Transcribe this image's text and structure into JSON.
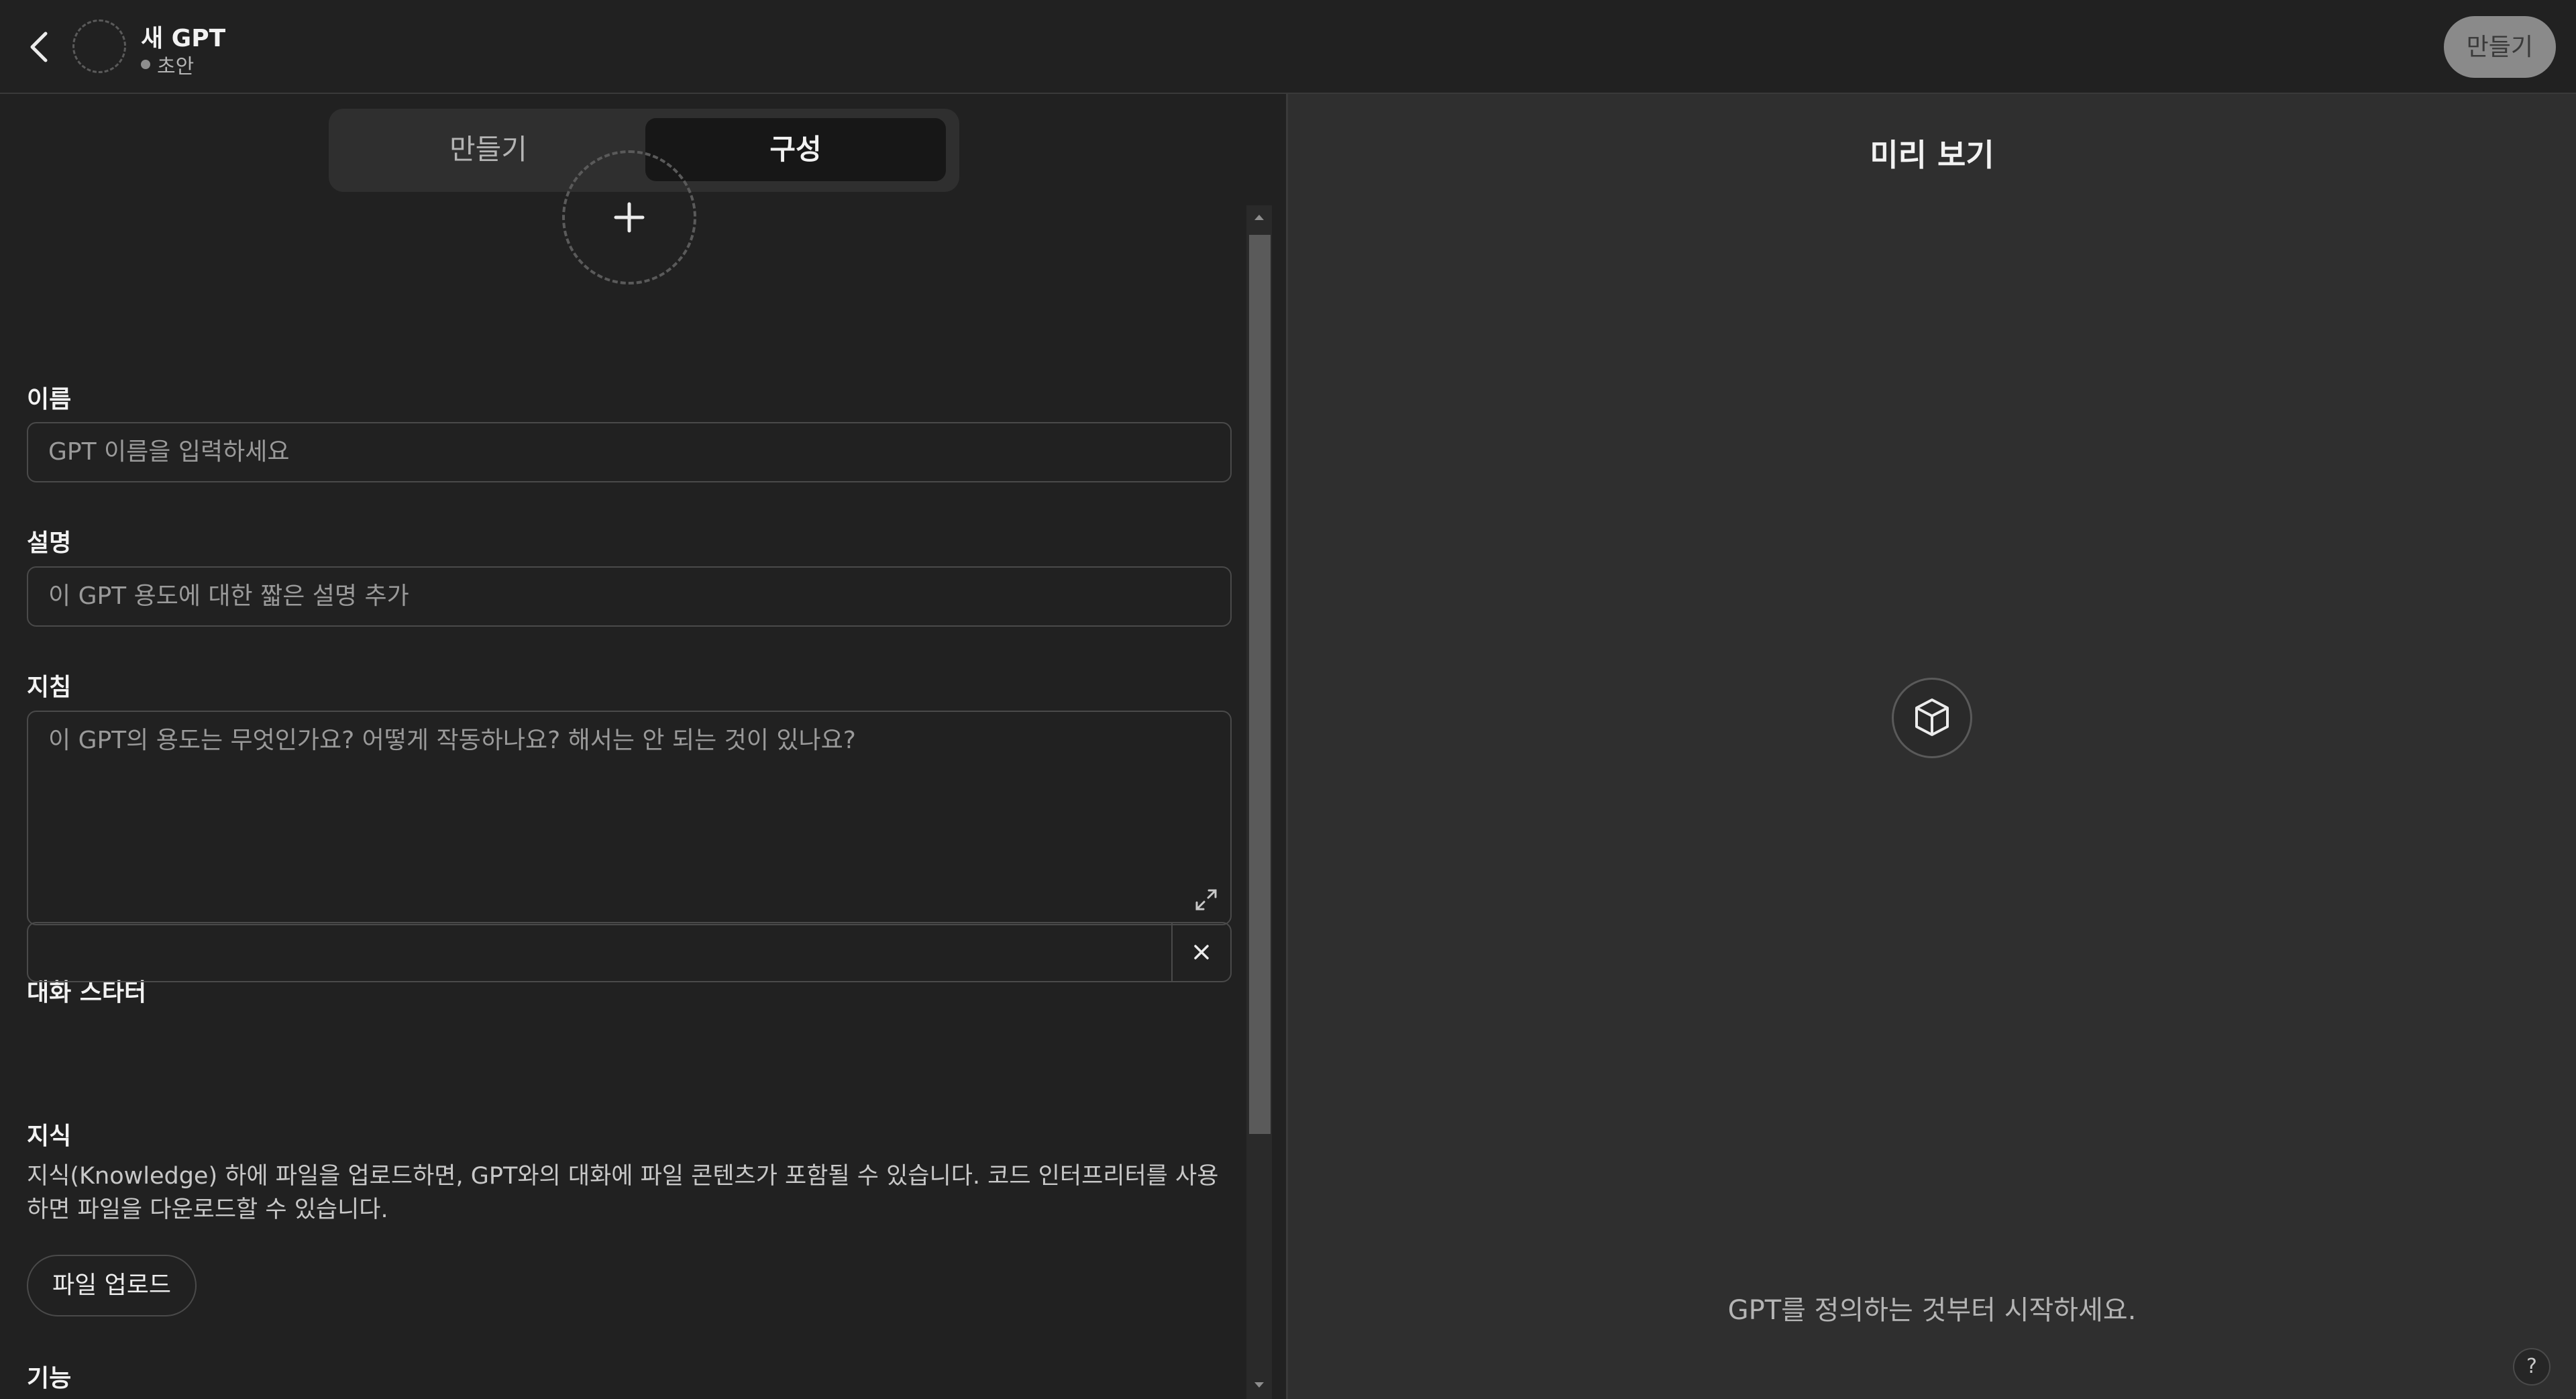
{
  "header": {
    "gpt_name": "새 GPT",
    "status": "초안",
    "create_button": "만들기"
  },
  "tabs": [
    {
      "label": "만들기",
      "active": false
    },
    {
      "label": "구성",
      "active": true
    }
  ],
  "form": {
    "name_label": "이름",
    "name_placeholder": "GPT 이름을 입력하세요",
    "description_label": "설명",
    "description_placeholder": "이 GPT 용도에 대한 짧은 설명 추가",
    "instructions_label": "지침",
    "instructions_placeholder": "이 GPT의 용도는 무엇인가요? 어떻게 작동하나요? 해서는 안 되는 것이 있나요?",
    "starters_label": "대화 스타터",
    "knowledge_label": "지식",
    "knowledge_desc": "지식(Knowledge) 하에 파일을 업로드하면, GPT와의 대화에 파일 콘텐츠가 포함될 수 있습니다. 코드 인터프리터를 사용하면 파일을 다운로드할 수 있습니다.",
    "upload_button": "파일 업로드",
    "capabilities_label": "기능"
  },
  "preview": {
    "title": "미리 보기",
    "hint": "GPT를 정의하는 것부터 시작하세요.",
    "help": "?"
  },
  "colors": {
    "background": "#212121",
    "preview_bg": "#2f2f2f",
    "accent_button": "#8a8a8a"
  }
}
